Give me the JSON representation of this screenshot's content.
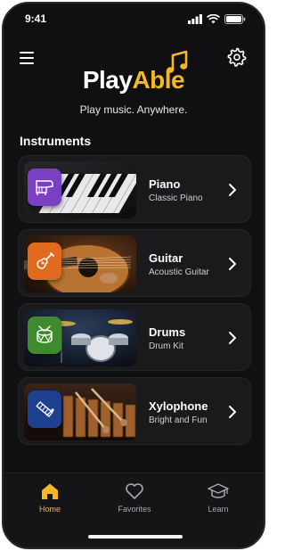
{
  "status": {
    "time": "9:41"
  },
  "brand": {
    "part1": "Play",
    "part2": "Able",
    "tagline": "Play music. Anywhere."
  },
  "section": {
    "title": "Instruments"
  },
  "instruments": [
    {
      "name": "Piano",
      "subtitle": "Classic Piano",
      "badge_color": "#7a3fc2",
      "icon": "grand-piano-icon"
    },
    {
      "name": "Guitar",
      "subtitle": "Acoustic Guitar",
      "badge_color": "#e06b1f",
      "icon": "guitar-icon"
    },
    {
      "name": "Drums",
      "subtitle": "Drum Kit",
      "badge_color": "#3f8a2e",
      "icon": "drum-icon"
    },
    {
      "name": "Xylophone",
      "subtitle": "Bright and Fun",
      "badge_color": "#1f3f8f",
      "icon": "xylophone-icon"
    }
  ],
  "tabs": [
    {
      "label": "Home",
      "icon": "home-icon",
      "active": true
    },
    {
      "label": "Favorites",
      "icon": "heart-icon",
      "active": false
    },
    {
      "label": "Learn",
      "icon": "graduation-cap-icon",
      "active": false
    }
  ],
  "colors": {
    "accent": "#f5b820",
    "background": "#101012",
    "card": "#1a1a1d"
  }
}
